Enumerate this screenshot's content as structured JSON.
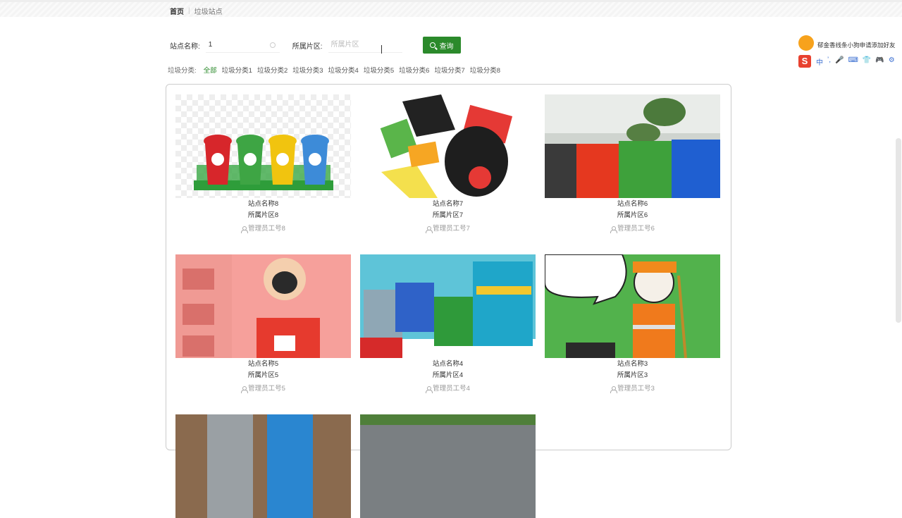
{
  "breadcrumb": {
    "home": "首页",
    "current": "垃圾站点"
  },
  "search": {
    "name_label": "站点名称:",
    "name_value": "1",
    "area_label": "所属片区:",
    "area_placeholder": "所属片区",
    "button_label": "查询"
  },
  "categories": {
    "label": "垃圾分类:",
    "items": [
      "全部",
      "垃圾分类1",
      "垃圾分类2",
      "垃圾分类3",
      "垃圾分类4",
      "垃圾分类5",
      "垃圾分类6",
      "垃圾分类7",
      "垃圾分类8"
    ],
    "active": "全部"
  },
  "cards": [
    {
      "name": "站点名称8",
      "area": "所属片区8",
      "admin": "管理员工号8"
    },
    {
      "name": "站点名称7",
      "area": "所属片区7",
      "admin": "管理员工号7"
    },
    {
      "name": "站点名称6",
      "area": "所属片区6",
      "admin": "管理员工号6"
    },
    {
      "name": "站点名称5",
      "area": "所属片区5",
      "admin": "管理员工号5"
    },
    {
      "name": "站点名称4",
      "area": "所属片区4",
      "admin": "管理员工号4"
    },
    {
      "name": "站点名称3",
      "area": "所属片区3",
      "admin": "管理员工号3"
    },
    {
      "name": "",
      "area": "",
      "admin": ""
    },
    {
      "name": "",
      "area": "",
      "admin": ""
    }
  ],
  "ime": {
    "message": "郁金香线条小狗申请添加好友",
    "logo": "S",
    "tools": [
      "中",
      "ʼ,",
      "🎤",
      "⌨",
      "👕",
      "🎮",
      "⚙"
    ]
  },
  "colors": {
    "accent": "#2b8a2b"
  }
}
